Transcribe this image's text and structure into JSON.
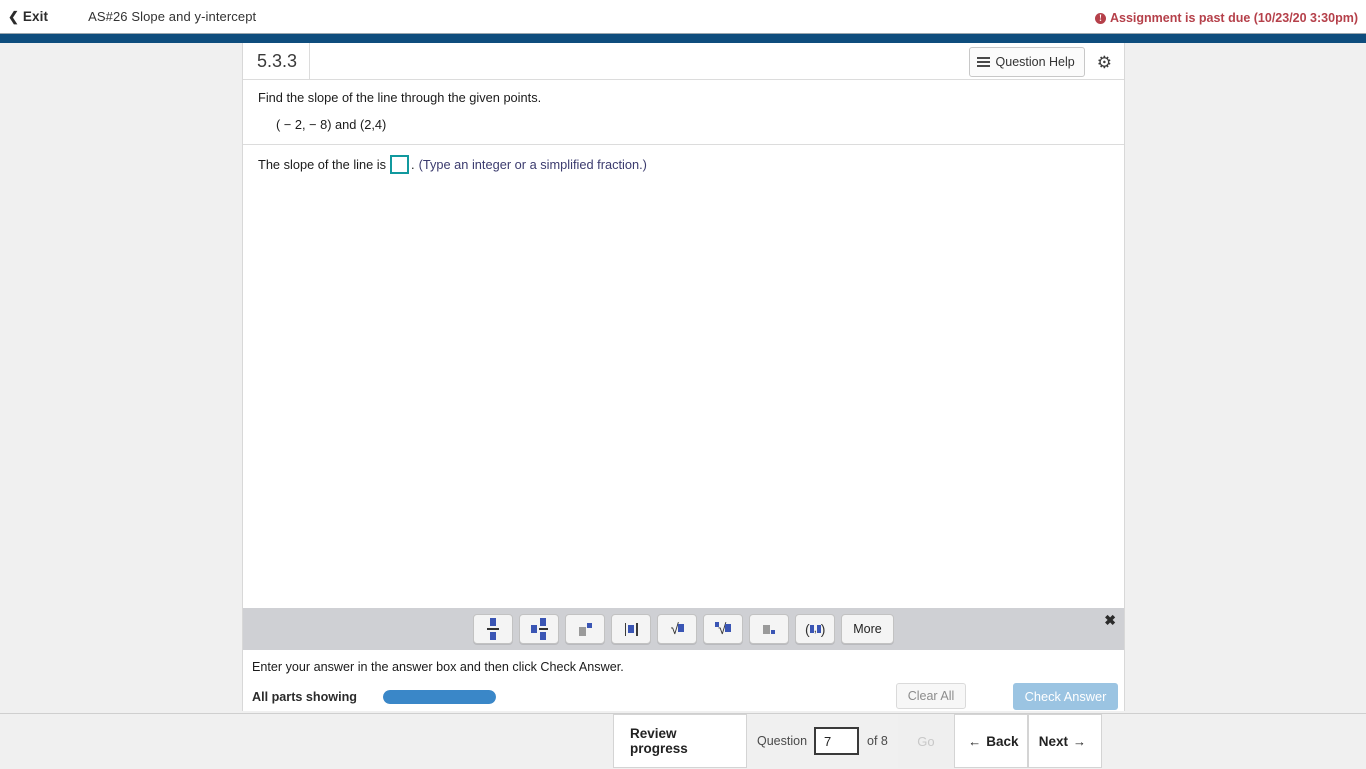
{
  "header": {
    "exit_label": "Exit",
    "exit_icon": "chevron-left-icon",
    "assignment_title": "AS#26 Slope and y-intercept",
    "past_due_text": "Assignment is past due (10/23/20 3:30pm)",
    "past_due_icon": "alert-circle-icon",
    "past_due_color": "#b5404a",
    "navy_strip_color": "#0e4d7d"
  },
  "question_header": {
    "number": "5.3.3",
    "help_label": "Question Help",
    "help_icon": "list-icon",
    "gear_icon": "gear-icon",
    "gear_glyph": "⚙"
  },
  "question": {
    "prompt": "Find the slope of the line through the given points.",
    "points": "( − 2, − 8) and (2,4)",
    "answer_prefix": "The slope of the line is",
    "answer_value": "",
    "answer_period": ".",
    "answer_hint": "(Type an integer or a simplified fraction.)",
    "answer_box_border_color": "#11999e",
    "hint_color": "#3b3b6e"
  },
  "math_palette": {
    "close_icon": "close-icon",
    "close_glyph": "✖",
    "buttons": [
      {
        "name": "fraction-button",
        "icon": "fraction-icon"
      },
      {
        "name": "mixed-number-button",
        "icon": "mixed-number-icon"
      },
      {
        "name": "exponent-button",
        "icon": "exponent-icon"
      },
      {
        "name": "absolute-value-button",
        "icon": "absolute-value-icon"
      },
      {
        "name": "square-root-button",
        "icon": "square-root-icon"
      },
      {
        "name": "nth-root-button",
        "icon": "nth-root-icon"
      },
      {
        "name": "subscript-button",
        "icon": "subscript-icon"
      },
      {
        "name": "ordered-pair-button",
        "icon": "ordered-pair-icon"
      }
    ],
    "more_label": "More"
  },
  "status": {
    "instruction": "Enter your answer in the answer box and then click Check Answer.",
    "parts_label": "All parts showing",
    "progress_percent": 100,
    "progress_color": "#3a87c8",
    "clear_all_label": "Clear All",
    "check_answer_label": "Check Answer",
    "check_answer_color": "#9bc4e2"
  },
  "bottom_nav": {
    "review_progress_label": "Review progress",
    "question_label": "Question",
    "question_value": "7",
    "of_label": "of 8",
    "go_label": "Go",
    "back_label": "Back",
    "back_icon": "arrow-left-icon",
    "back_arrow": "←",
    "next_label": "Next",
    "next_icon": "arrow-right-icon",
    "next_arrow": "→"
  }
}
